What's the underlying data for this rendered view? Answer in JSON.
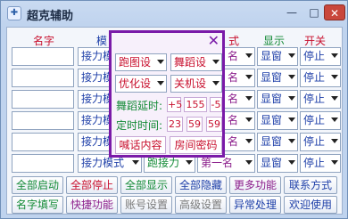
{
  "window": {
    "title": "超克辅助",
    "icon": "app-icon",
    "controls": {
      "minimize": "—",
      "maximize": "□",
      "close": "✕"
    }
  },
  "headers": {
    "name": "名字",
    "mode": "模",
    "style": "式",
    "display": "显示",
    "switch": "开关"
  },
  "rows": [
    {
      "mode": "接力模",
      "rank": "名",
      "display": "显窗",
      "switch": "停止"
    },
    {
      "mode": "接力模",
      "rank": "名",
      "display": "显窗",
      "switch": "停止"
    },
    {
      "mode": "接力模",
      "rank": "名",
      "display": "显窗",
      "switch": "停止"
    },
    {
      "mode": "接力模",
      "rank": "名",
      "display": "显窗",
      "switch": "停止"
    },
    {
      "mode": "接力模",
      "rank": "名",
      "display": "显窗",
      "switch": "停止"
    },
    {
      "mode": "接力模式",
      "dance": "跑接力",
      "rank": "第一名",
      "display": "显窗",
      "switch": "停止"
    }
  ],
  "buttons_row1": [
    "全部启动",
    "全部停止",
    "全部显示",
    "全部隐藏",
    "更多功能",
    "联系方式"
  ],
  "buttons_row2": [
    "名字填写",
    "快捷功能",
    "账号设置",
    "高级设置",
    "异常处理",
    "欢迎使用"
  ],
  "popup": {
    "combo1": "跑图设",
    "combo2": "舞蹈设",
    "combo3": "优化设",
    "combo4": "关机设",
    "delay_label": "舞蹈延时:",
    "delay_values": [
      "+5",
      "155",
      "-5"
    ],
    "timer_label": "定时时间:",
    "timer_values": [
      "23",
      "59",
      "59"
    ],
    "shout_button": "喊话内容",
    "room_password_button": "房间密码",
    "close": "✕"
  }
}
